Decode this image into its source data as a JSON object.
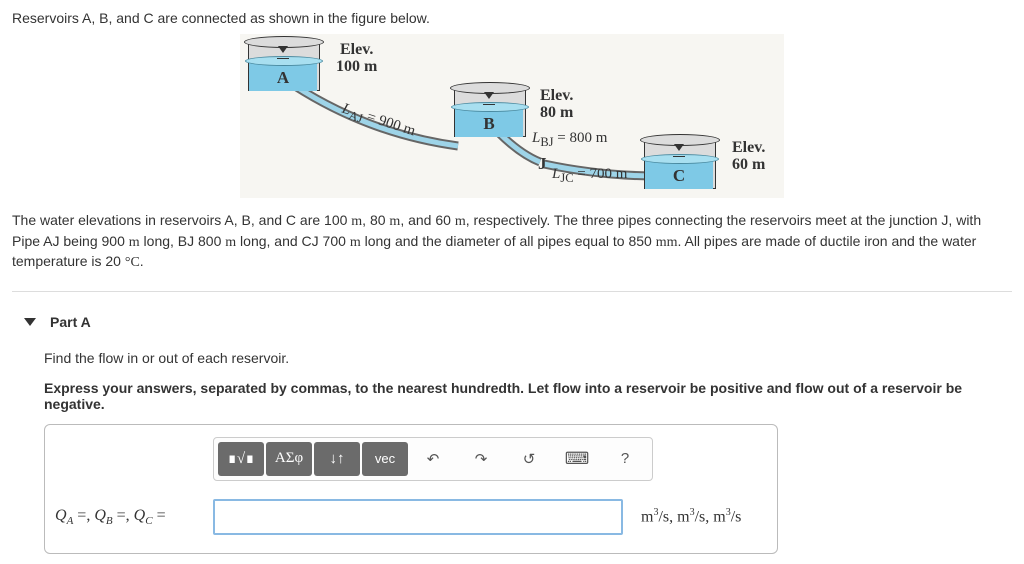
{
  "intro": "Reservoirs A, B, and C are connected as shown in the figure below.",
  "diagram": {
    "tankA": {
      "name": "A",
      "elevLabel": "Elev.",
      "elev": "100 m"
    },
    "tankB": {
      "name": "B",
      "elevLabel": "Elev.",
      "elev": "80 m"
    },
    "tankC": {
      "name": "C",
      "elevLabel": "Elev.",
      "elev": "60 m"
    },
    "pipeAJ": "Lᴀᴊ = 900 m",
    "pipeBJ": "Lʙᴊ = 800 m",
    "pipeJC": "Lᴊᴄ = 700 m",
    "junction": "J"
  },
  "description_html": "The water elevations in reservoirs A, B, and C are 100 <span class='unit'>m</span>, 80 <span class='unit'>m</span>, and 60 <span class='unit'>m</span>, respectively. The three pipes connecting the reservoirs meet at the junction J, with Pipe AJ being 900 <span class='unit'>m</span> long, BJ 800 <span class='unit'>m</span> long, and CJ 700 <span class='unit'>m</span> long and the diameter of all pipes equal to 850 <span class='unit'>mm</span>. All pipes are made of ductile iron and the water temperature is 20 <span class='unit'>°C</span>.",
  "part": {
    "title": "Part A",
    "instr1": "Find the flow in or out of each reservoir.",
    "instr2": "Express your answers, separated by commas, to the nearest hundredth. Let flow into a reservoir be positive and flow out of a reservoir be negative."
  },
  "toolbar": {
    "templates": "∎√∎",
    "greek": "ΑΣφ",
    "subsup": "↓↑",
    "vec": "vec",
    "undo": "↶",
    "redo": "↷",
    "reset": "↺",
    "keyboard": "⌨",
    "help": "?"
  },
  "answer": {
    "label_html": "Q<span class='sub'>A</span> <span class='eq'>=,</span> Q<span class='sub'>B</span> <span class='eq'>=,</span> Q<span class='sub'>C</span> <span class='eq'>=</span>",
    "value": "",
    "units_html": "m<sup>3</sup>/s, m<sup>3</sup>/s, m<sup>3</sup>/s"
  }
}
